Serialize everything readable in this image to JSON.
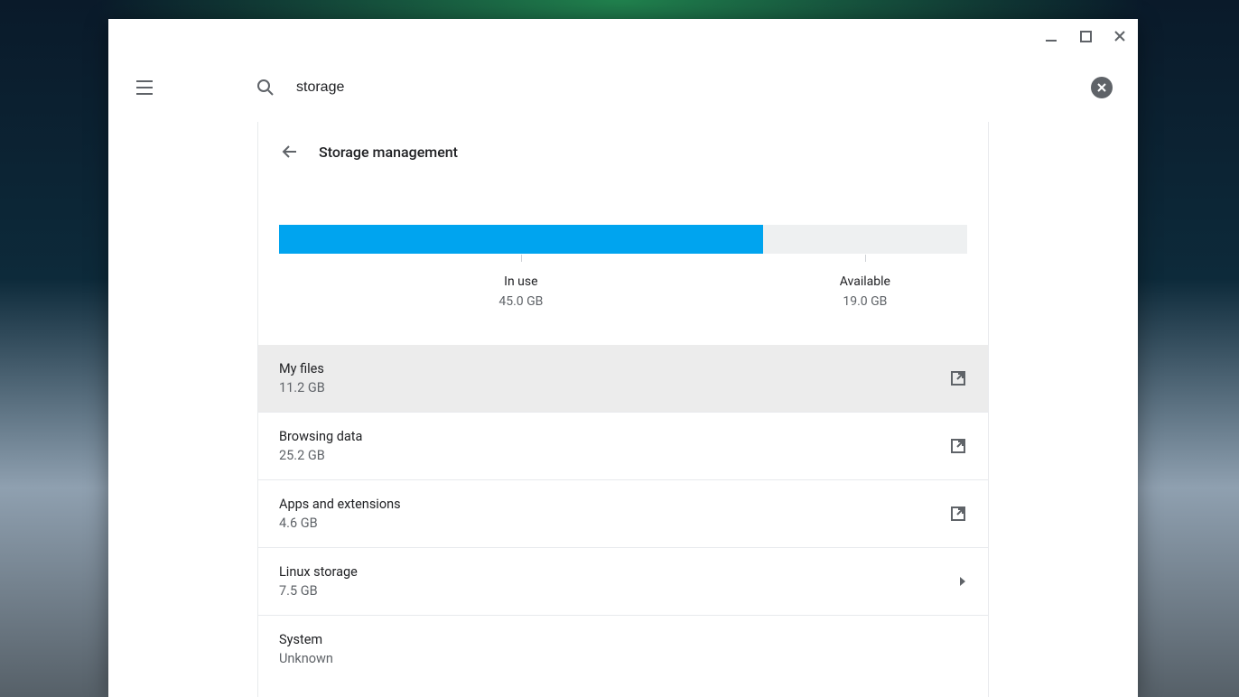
{
  "search": {
    "value": "storage"
  },
  "page_title": "Storage management",
  "chart_data": {
    "type": "bar",
    "title": "",
    "categories": [
      "In use",
      "Available"
    ],
    "values_gb": [
      45.0,
      19.0
    ],
    "values_display": [
      "45.0 GB",
      "19.0 GB"
    ],
    "total_gb": 64.0,
    "in_use_pct": 70.3
  },
  "labels": {
    "in_use": "In use",
    "available": "Available",
    "in_use_val": "45.0 GB",
    "available_val": "19.0 GB"
  },
  "rows": [
    {
      "title": "My files",
      "value": "11.2 GB",
      "icon": "open",
      "hl": true
    },
    {
      "title": "Browsing data",
      "value": "25.2 GB",
      "icon": "open",
      "hl": false
    },
    {
      "title": "Apps and extensions",
      "value": "4.6 GB",
      "icon": "open",
      "hl": false
    },
    {
      "title": "Linux storage",
      "value": "7.5 GB",
      "icon": "caret",
      "hl": false
    },
    {
      "title": "System",
      "value": "Unknown",
      "icon": "none",
      "hl": false
    }
  ]
}
